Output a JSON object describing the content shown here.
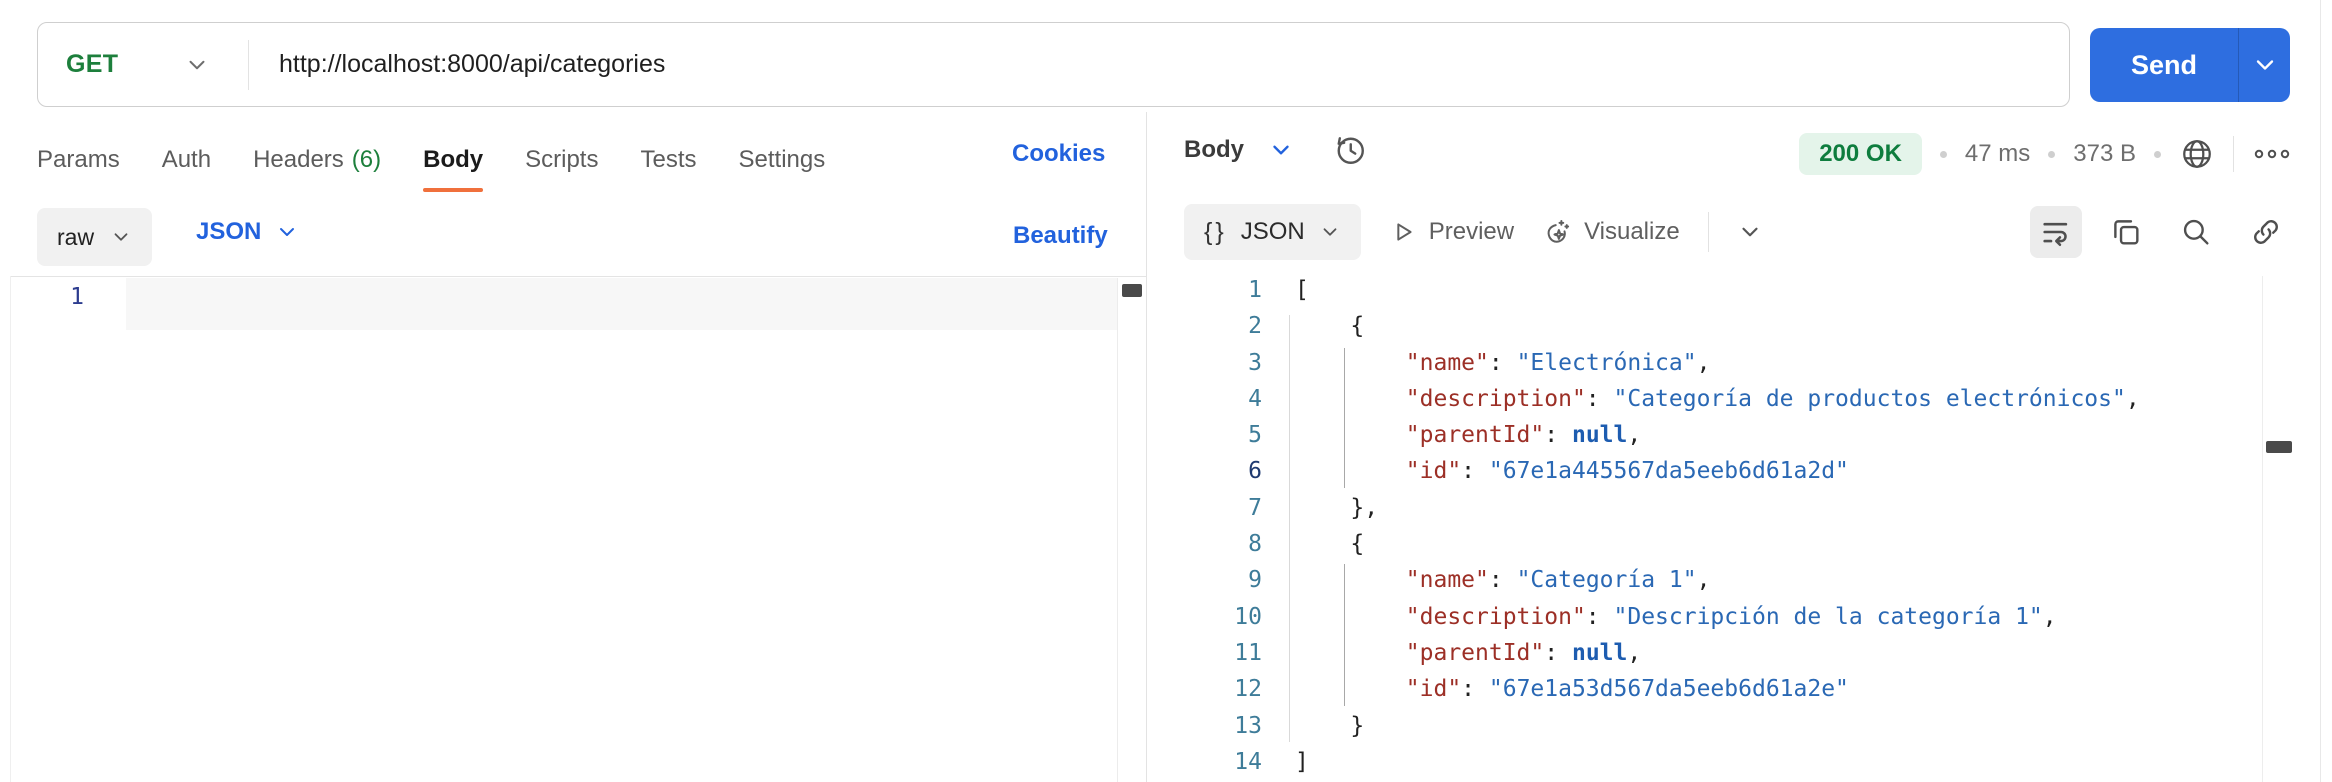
{
  "colors": {
    "accent_blue": "#2262dd",
    "send_button_blue": "#2e6ee0",
    "method_green": "#1d7f3c",
    "status_green": "#0e7d3e",
    "status_pill_bg": "#e4f4ea",
    "active_tab_underline_orange": "#f0703c",
    "syntax_key_red": "#9c2f26",
    "syntax_string_blue": "#2a68b4",
    "syntax_null_blue": "#1d5cb0",
    "line_number_teal": "#3e7c99"
  },
  "request": {
    "method": "GET",
    "url": "http://localhost:8000/api/categories",
    "send_label": "Send",
    "tabs": [
      {
        "label": "Params"
      },
      {
        "label": "Auth"
      },
      {
        "label": "Headers",
        "badge": "(6)"
      },
      {
        "label": "Body",
        "active": true
      },
      {
        "label": "Scripts"
      },
      {
        "label": "Tests"
      },
      {
        "label": "Settings"
      }
    ],
    "cookies_label": "Cookies",
    "body_toolbar": {
      "format": "raw",
      "language": "JSON",
      "beautify": "Beautify"
    },
    "editor": {
      "active_line_number": "1"
    }
  },
  "response": {
    "pane_label": "Body",
    "status": {
      "code": "200 OK",
      "time": "47 ms",
      "size": "373 B"
    },
    "toolbar": {
      "format_icon": "{}",
      "format": "JSON",
      "preview": "Preview",
      "visualize": "Visualize"
    },
    "code": {
      "lines": [
        {
          "n": "1",
          "indent": 0,
          "tokens": [
            {
              "t": "punc",
              "v": "["
            }
          ]
        },
        {
          "n": "2",
          "indent": 1,
          "tokens": [
            {
              "t": "punc",
              "v": "{"
            }
          ]
        },
        {
          "n": "3",
          "indent": 2,
          "tokens": [
            {
              "t": "key",
              "v": "\"name\""
            },
            {
              "t": "punc",
              "v": ": "
            },
            {
              "t": "str",
              "v": "\"Electrónica\""
            },
            {
              "t": "punc",
              "v": ","
            }
          ]
        },
        {
          "n": "4",
          "indent": 2,
          "tokens": [
            {
              "t": "key",
              "v": "\"description\""
            },
            {
              "t": "punc",
              "v": ": "
            },
            {
              "t": "str",
              "v": "\"Categoría de productos electrónicos\""
            },
            {
              "t": "punc",
              "v": ","
            }
          ]
        },
        {
          "n": "5",
          "indent": 2,
          "tokens": [
            {
              "t": "key",
              "v": "\"parentId\""
            },
            {
              "t": "punc",
              "v": ": "
            },
            {
              "t": "null",
              "v": "null"
            },
            {
              "t": "punc",
              "v": ","
            }
          ]
        },
        {
          "n": "6",
          "indent": 2,
          "active": true,
          "tokens": [
            {
              "t": "key",
              "v": "\"id\""
            },
            {
              "t": "punc",
              "v": ": "
            },
            {
              "t": "str",
              "v": "\"67e1a445567da5eeb6d61a2d\""
            }
          ]
        },
        {
          "n": "7",
          "indent": 1,
          "tokens": [
            {
              "t": "punc",
              "v": "},"
            }
          ]
        },
        {
          "n": "8",
          "indent": 1,
          "tokens": [
            {
              "t": "punc",
              "v": "{"
            }
          ]
        },
        {
          "n": "9",
          "indent": 2,
          "tokens": [
            {
              "t": "key",
              "v": "\"name\""
            },
            {
              "t": "punc",
              "v": ": "
            },
            {
              "t": "str",
              "v": "\"Categoría 1\""
            },
            {
              "t": "punc",
              "v": ","
            }
          ]
        },
        {
          "n": "10",
          "indent": 2,
          "tokens": [
            {
              "t": "key",
              "v": "\"description\""
            },
            {
              "t": "punc",
              "v": ": "
            },
            {
              "t": "str",
              "v": "\"Descripción de la categoría 1\""
            },
            {
              "t": "punc",
              "v": ","
            }
          ]
        },
        {
          "n": "11",
          "indent": 2,
          "tokens": [
            {
              "t": "key",
              "v": "\"parentId\""
            },
            {
              "t": "punc",
              "v": ": "
            },
            {
              "t": "null",
              "v": "null"
            },
            {
              "t": "punc",
              "v": ","
            }
          ]
        },
        {
          "n": "12",
          "indent": 2,
          "tokens": [
            {
              "t": "key",
              "v": "\"id\""
            },
            {
              "t": "punc",
              "v": ": "
            },
            {
              "t": "str",
              "v": "\"67e1a53d567da5eeb6d61a2e\""
            }
          ]
        },
        {
          "n": "13",
          "indent": 1,
          "tokens": [
            {
              "t": "punc",
              "v": "}"
            }
          ]
        },
        {
          "n": "14",
          "indent": 0,
          "tokens": [
            {
              "t": "punc",
              "v": "]"
            }
          ]
        }
      ]
    }
  }
}
